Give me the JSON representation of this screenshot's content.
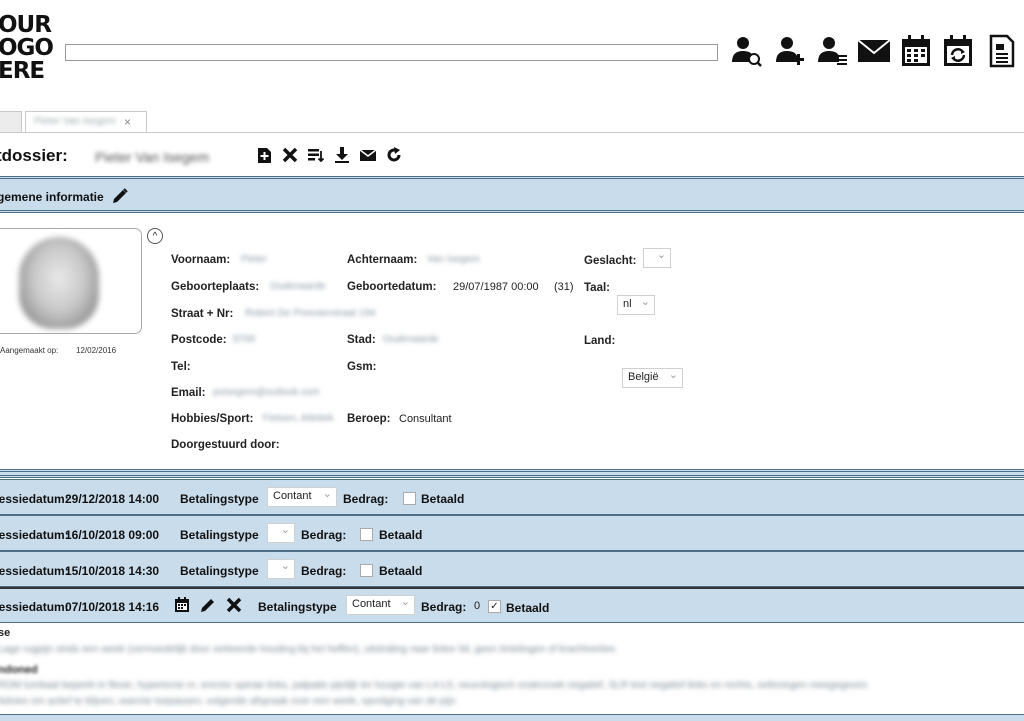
{
  "logo": {
    "line1": "OUR",
    "line2": "OGO",
    "line3": "ERE"
  },
  "search": {
    "value": ""
  },
  "toolbar_icons": [
    "search-person-icon",
    "add-person-icon",
    "person-list-icon",
    "envelope-icon",
    "calendar-icon",
    "calendar-refresh-icon",
    "document-icon"
  ],
  "tabs": {
    "inactive_label": "",
    "active_label": "Pieter Van Isegem",
    "close_glyph": "×"
  },
  "header": {
    "title": "tdossier:",
    "patient_name": "Pieter Van Isegem"
  },
  "section": {
    "title": "gemene informatie"
  },
  "photo": {
    "created_label": "Aangemaakt op:",
    "created_value": "12/02/2016"
  },
  "fields": {
    "voornaam_label": "Voornaam:",
    "voornaam": "Pieter",
    "achternaam_label": "Achternaam:",
    "achternaam": "Van Isegem",
    "geslacht_label": "Geslacht:",
    "geslacht": "",
    "geboorteplaats_label": "Geboorteplaats:",
    "geboorteplaats": "Oudenaarde",
    "geboortedatum_label": "Geboortedatum:",
    "geboortedatum": "29/07/1987 00:00",
    "leeftijd": "(31)",
    "taal_label": "Taal:",
    "taal": "nl",
    "straat_label": "Straat + Nr:",
    "straat": "Robert De Preesterstraat 194",
    "postcode_label": "Postcode:",
    "postcode": "9700",
    "stad_label": "Stad:",
    "stad": "Oudenaarde",
    "land_label": "Land:",
    "land": "België",
    "tel_label": "Tel:",
    "gsm_label": "Gsm:",
    "email_label": "Email:",
    "email": "pvisegem@outlook.com",
    "hobbies_label": "Hobbies/Sport:",
    "hobbies": "Fietsen, Atletiek",
    "beroep_label": "Beroep:",
    "beroep": "Consultant",
    "doorgestuurd_label": "Doorgestuurd door:"
  },
  "sessions": [
    {
      "label": "sessiedatum:",
      "date": "29/12/2018 14:00",
      "type_label": "Betalingstype",
      "type": "Contant",
      "amount_label": "Bedrag:",
      "amount": "",
      "paid_label": "Betaald",
      "paid_mark": ""
    },
    {
      "label": "sessiedatum:",
      "date": "16/10/2018 09:00",
      "type_label": "Betalingstype",
      "type": "",
      "amount_label": "Bedrag:",
      "amount": "",
      "paid_label": "Betaald",
      "paid_mark": ""
    },
    {
      "label": "sessiedatum:",
      "date": "15/10/2018 14:30",
      "type_label": "Betalingstype",
      "type": "",
      "amount_label": "Bedrag:",
      "amount": "",
      "paid_label": "Betaald",
      "paid_mark": ""
    },
    {
      "label": "sessiedatum:",
      "date": "07/10/2018 14:16",
      "type_label": "Betalingstype",
      "type": "Contant",
      "amount_label": "Bedrag:",
      "amount": "0",
      "paid_label": "Betaald",
      "paid_mark": "✓"
    }
  ],
  "notes": {
    "heading1": "se",
    "line1": "Lage rugpijn sinds een week (vermoedelijk door verkeerde houding bij het heffen), uitstraling naar linker bil, geen tintelingen of krachtverlies",
    "heading2": "ndoned",
    "line2": "ROM lumbaal beperkt in flexie, hypertonie m. erector spinae links, palpatie pijnlijk ter hoogte van L4-L5, neurologisch onderzoek negatief, SLR test negatief links en rechts, oefeningen meegegeven",
    "line3": "Advies om actief te blijven, warmte toepassen, volgende afspraak over een week, opvolging van de pijn"
  }
}
